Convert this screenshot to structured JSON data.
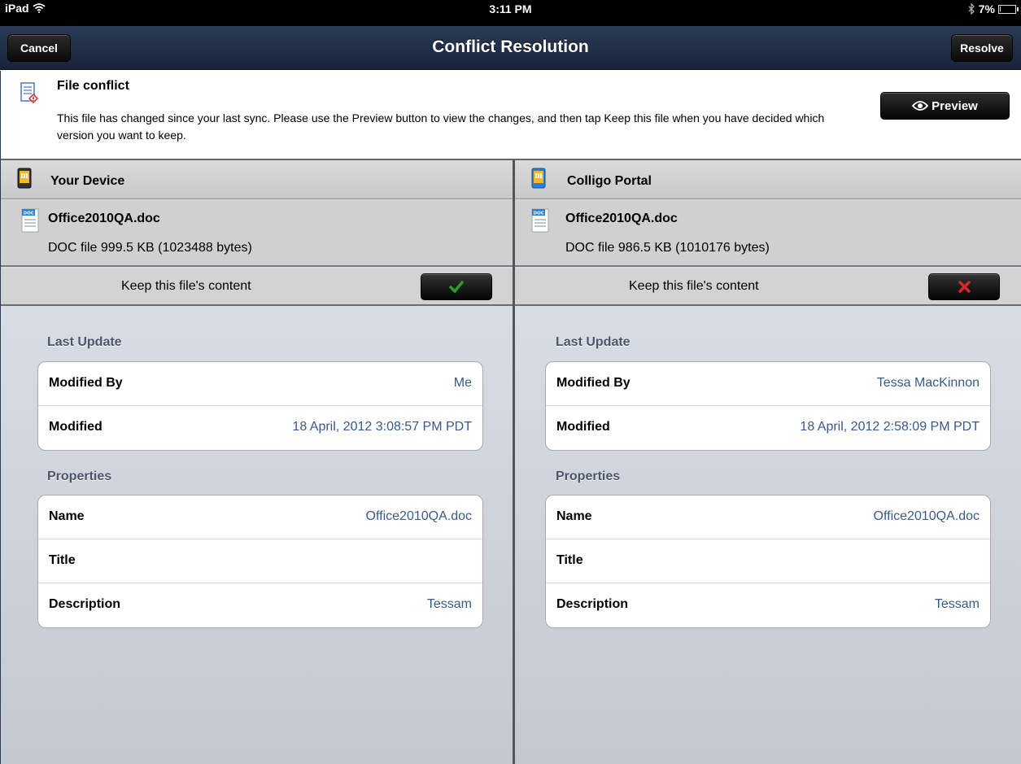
{
  "status_bar": {
    "device": "iPad",
    "time": "3:11 PM",
    "battery": "7%",
    "battery_level": 0.07
  },
  "nav": {
    "title": "Conflict Resolution",
    "cancel_label": "Cancel",
    "resolve_label": "Resolve"
  },
  "conflict": {
    "heading": "File conflict",
    "message": "This file has changed since your last sync. Please use the Preview button to view the changes, and then tap Keep this file when you have decided which version you want to keep.",
    "preview_label": "Preview"
  },
  "left": {
    "source": "Your Device",
    "file_name": "Office2010QA.doc",
    "file_info": "DOC file  999.5 KB (1023488 bytes)",
    "file_type_badge": "DOC",
    "keep_label": "Keep this file's content",
    "keep_state": "checked",
    "last_update_title": "Last Update",
    "last_update": [
      {
        "label": "Modified By",
        "value": "Me"
      },
      {
        "label": "Modified",
        "value": "18 April, 2012 3:08:57 PM PDT"
      }
    ],
    "properties_title": "Properties",
    "properties": [
      {
        "label": "Name",
        "value": "Office2010QA.doc"
      },
      {
        "label": "Title",
        "value": ""
      },
      {
        "label": "Description",
        "value": "Tessam"
      }
    ]
  },
  "right": {
    "source": "Colligo Portal",
    "file_name": "Office2010QA.doc",
    "file_info": "DOC file  986.5 KB (1010176 bytes)",
    "file_type_badge": "DOC",
    "keep_label": "Keep this file's content",
    "keep_state": "unchecked",
    "last_update_title": "Last Update",
    "last_update": [
      {
        "label": "Modified By",
        "value": "Tessa MacKinnon"
      },
      {
        "label": "Modified",
        "value": "18 April, 2012 2:58:09 PM PDT"
      }
    ],
    "properties_title": "Properties",
    "properties": [
      {
        "label": "Name",
        "value": "Office2010QA.doc"
      },
      {
        "label": "Title",
        "value": ""
      },
      {
        "label": "Description",
        "value": "Tessam"
      }
    ]
  },
  "colors": {
    "nav_bar": "#1f2d47",
    "value_text": "#3a5a8a",
    "section_title": "#4c566b",
    "check_green": "#2e9e1f",
    "cross_red": "#d8242a"
  },
  "icons": {
    "wifi": "wifi-icon",
    "bluetooth": "bluetooth-icon",
    "battery": "battery-icon",
    "conflict": "document-conflict-icon",
    "preview": "eye-icon",
    "device": "device-icon",
    "portal": "portal-icon",
    "doc": "doc-file-icon",
    "check": "checkmark-icon",
    "cross": "cross-icon"
  }
}
